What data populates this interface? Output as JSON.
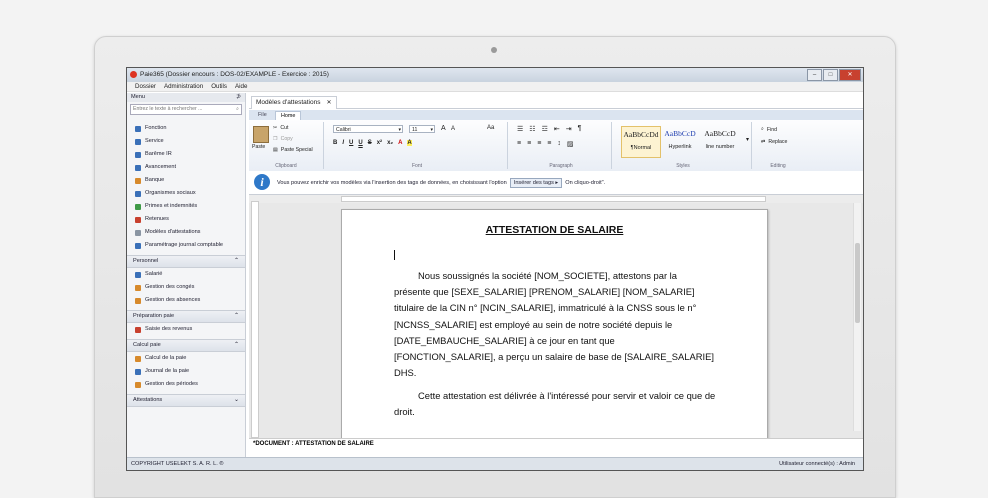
{
  "window": {
    "title": "Paie365 (Dossier encours : DOS-02/EXAMPLE - Exercice : 2015)",
    "minimize": "–",
    "maximize": "□",
    "close": "✕"
  },
  "menubar": [
    "Dossier",
    "Administration",
    "Outils",
    "Aide"
  ],
  "leftpanel": {
    "header": "Menu",
    "pin": "⊅",
    "search_placeholder": "Entrez le texte à rechercher ...",
    "items": [
      {
        "label": "Fonction",
        "icon": "grid-icon"
      },
      {
        "label": "Service",
        "icon": "grid-icon"
      },
      {
        "label": "Barême IR",
        "icon": "grid-icon"
      },
      {
        "label": "Avancement",
        "icon": "grid-icon"
      },
      {
        "label": "Banque",
        "icon": "bank-icon"
      },
      {
        "label": "Organismes sociaux",
        "icon": "grid-icon"
      },
      {
        "label": "Primes et indemnités",
        "icon": "check-icon"
      },
      {
        "label": "Retenues",
        "icon": "pencil-icon"
      },
      {
        "label": "Modèles d'attestations",
        "icon": "document-icon"
      },
      {
        "label": "Paramétrage journal comptable",
        "icon": "grid-icon"
      }
    ],
    "sections": [
      {
        "title": "Personnel",
        "items": [
          "Salarié",
          "Gestion des congés",
          "Gestion des absences"
        ]
      },
      {
        "title": "Préparation paie",
        "items": [
          "Saisie des revenus"
        ]
      },
      {
        "title": "Calcul paie",
        "items": [
          "Calcul de la paie",
          "Journal de la paie",
          "Gestion des périodes"
        ]
      },
      {
        "title": "Attestations",
        "items": []
      }
    ]
  },
  "doctab": {
    "label": "Modèles d'attestations",
    "close": "✕"
  },
  "ribbon": {
    "tabs": {
      "file": "File",
      "home": "Home"
    },
    "clipboard": {
      "paste": "Paste",
      "cut": "Cut",
      "copy": "Copy",
      "paste_special": "Paste Special",
      "label": "Clipboard"
    },
    "font": {
      "name": "Calibri",
      "size": "11",
      "grow": "A",
      "shrink": "A",
      "case": "Aa",
      "label": "Font",
      "format_buttons": [
        "B",
        "I",
        "U",
        "U",
        "S",
        "x²",
        "x₂",
        "A",
        "A"
      ]
    },
    "paragraph": {
      "label": "Paragraph"
    },
    "styles": {
      "label": "Styles",
      "items": [
        {
          "sample": "AaBbCcDd",
          "name": "¶Normal",
          "selected": true
        },
        {
          "sample": "AaBbCcD",
          "name": "Hyperlink",
          "selected": false
        },
        {
          "sample": "AaBbCcD",
          "name": "line number",
          "selected": false
        }
      ]
    },
    "editing": {
      "find": "Find",
      "replace": "Replace",
      "label": "Editing"
    }
  },
  "infobar": {
    "text_before": "Vous pouvez enrichir vos modèles via l'insertion des tags de données,  en choisissant  l'option",
    "button": "Insérer des tags ▸",
    "text_after": "  On cliquo-droit\"."
  },
  "document": {
    "title": "ATTESTATION DE SALAIRE",
    "paragraph1": "Nous soussignés la société [NOM_SOCIETE], attestons par la présente que [SEXE_SALARIE] [PRENOM_SALARIE] [NOM_SALARIE] titulaire de la CIN n° [NCIN_SALARIE], immatriculé à la CNSS sous le n° [NCNSS_SALARIE] est employé au sein de notre société depuis le [DATE_EMBAUCHE_SALARIE]  à ce jour en tant que [FONCTION_SALARIE], a perçu  un salaire de base de [SALAIRE_SALARIE] DHS.",
    "paragraph2": "Cette attestation est délivrée à l'intéressé pour servir et valoir ce que de droit.",
    "label": "*DOCUMENT : ATTESTATION DE SALAIRE"
  },
  "statusbar": {
    "copyright": "COPYRIGHT USELEKT S. A. R. L. ®",
    "user": "Utilisateur connecté(s) : Admin"
  }
}
